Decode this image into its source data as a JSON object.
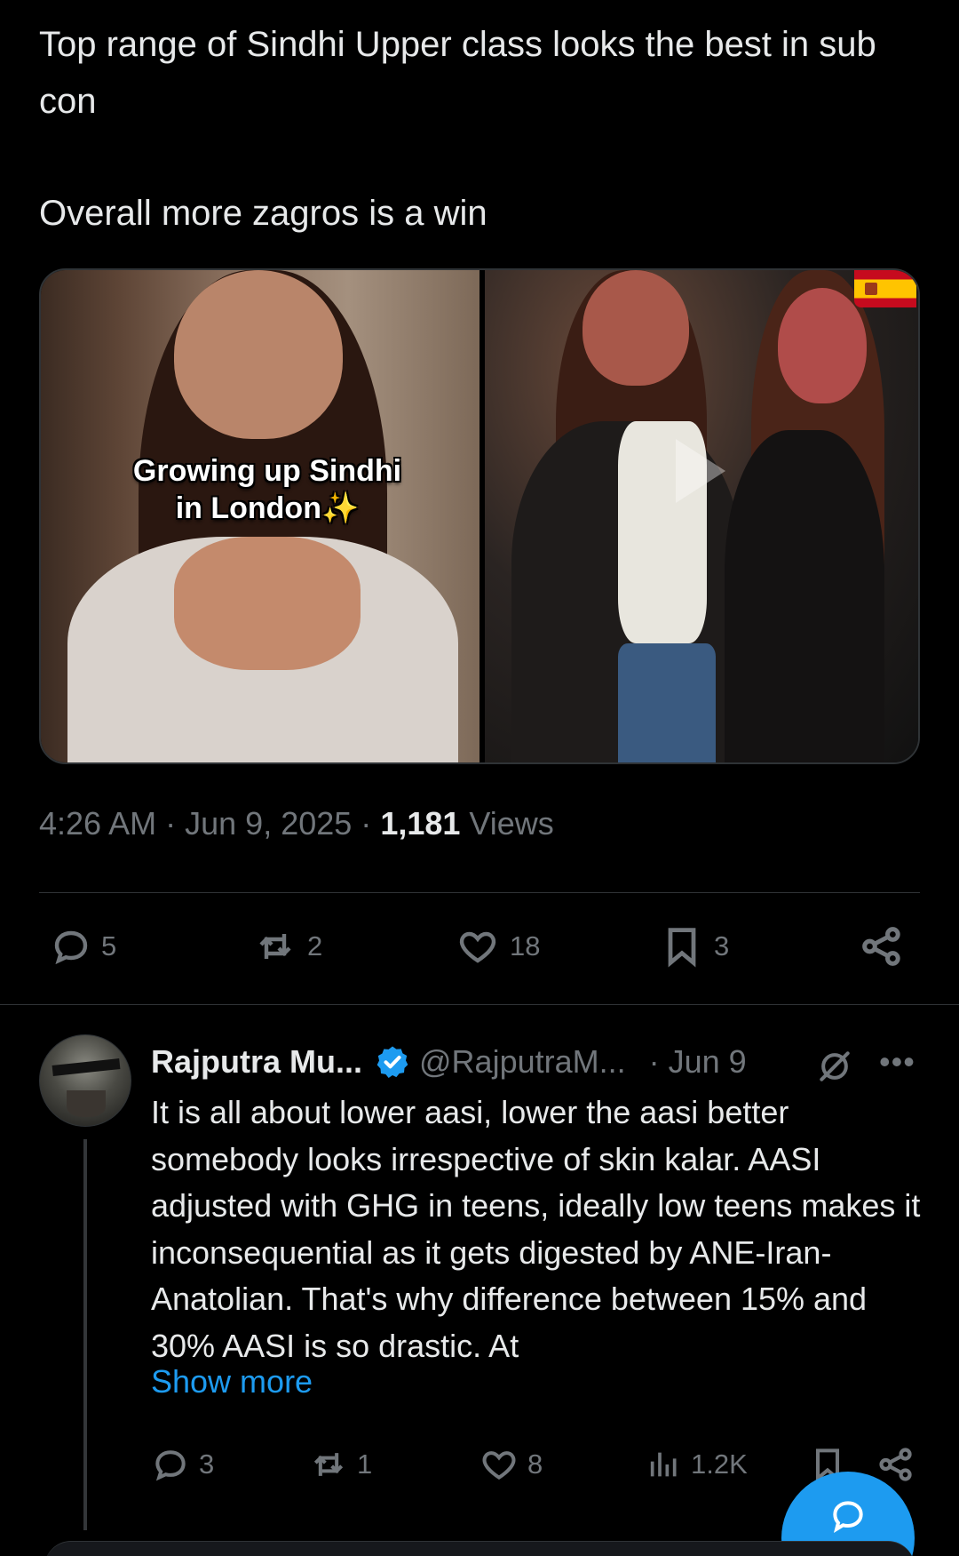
{
  "tweet": {
    "line1": "Top range of Sindhi Upper class looks the best in sub con",
    "line2": "Overall more zagros is a win",
    "media_caption": "Growing up Sindhi in London",
    "media_caption_emoji": "✨",
    "time": "4:26 AM",
    "date": "Jun 9, 2025",
    "views_count": "1,181",
    "views_label": "Views",
    "sep": "·"
  },
  "actions": {
    "replies": "5",
    "reposts": "2",
    "likes": "18",
    "bookmarks": "3"
  },
  "reply": {
    "name": "Rajputra Mu...",
    "handle": "@RajputraM...",
    "date": "· Jun 9",
    "more": "•••",
    "text": "It is all about lower aasi, lower the aasi better somebody looks irrespective of skin kalar. AASI adjusted with GHG in teens, ideally low teens makes it inconsequential as it gets digested by ANE-Iran-Anatolian. That's why difference between 15% and 30% AASI is so drastic. At",
    "show_more": "Show more",
    "replies": "3",
    "reposts": "1",
    "likes": "8",
    "views": "1.2K"
  },
  "colors": {
    "background": "#000000",
    "text": "#e7e9ea",
    "muted": "#71767b",
    "accent": "#1d9bf0",
    "divider": "#2f3336"
  },
  "icons": [
    "play-icon",
    "flag-icon",
    "reply-icon",
    "repost-icon",
    "like-icon",
    "bookmark-icon",
    "share-icon",
    "verified-icon",
    "grok-icon",
    "more-icon",
    "views-icon",
    "compose-icon"
  ]
}
